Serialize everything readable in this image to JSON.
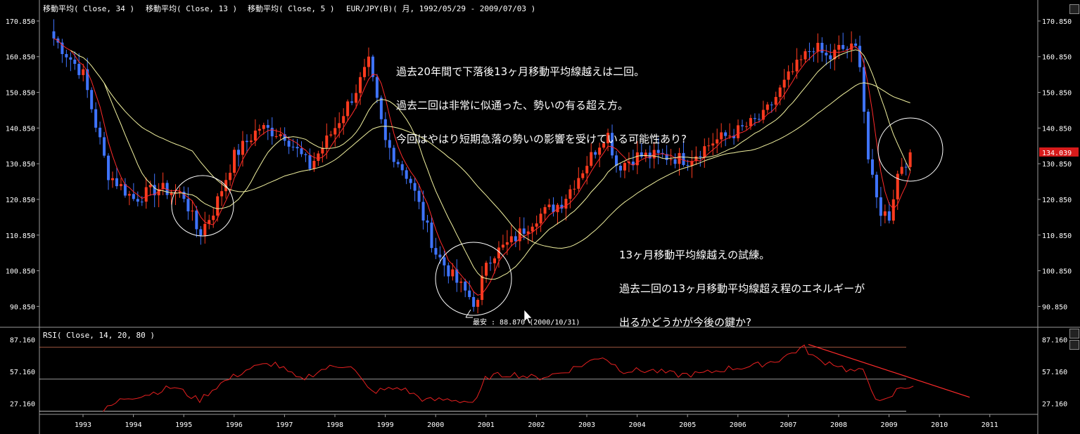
{
  "header": {
    "indicators": [
      "移動平均( Close, 34 )",
      "移動平均( Close, 13 )",
      "移動平均( Close, 5 )"
    ],
    "symbol": "EUR/JPY(B)( 月, 1992/05/29 - 2009/07/03 )"
  },
  "price_axis": {
    "ticks": [
      "170.850",
      "160.850",
      "150.850",
      "140.850",
      "130.850",
      "120.850",
      "110.850",
      "100.850",
      "90.850"
    ],
    "current_price": "134.039"
  },
  "rsi_panel": {
    "title": "RSI( Close, 14, 20, 80 )",
    "ticks": [
      "87.160",
      "57.160",
      "27.160"
    ]
  },
  "time_axis": {
    "years": [
      "1993",
      "1994",
      "1995",
      "1996",
      "1997",
      "1998",
      "1999",
      "2000",
      "2001",
      "2002",
      "2003",
      "2004",
      "2005",
      "2006",
      "2007",
      "2008",
      "2009",
      "2010",
      "2011"
    ]
  },
  "annotations": {
    "top_note": [
      "過去20年間で下落後13ヶ月移動平均線越えは二回。",
      "過去二回は非常に似通った、勢いの有る超え方。",
      "今回はやはり短期急落の勢いの影響を受けている可能性あり?"
    ],
    "right_note": [
      "13ヶ月移動平均線越えの試練。",
      "過去二回の13ヶ月移動平均線超え程のエネルギーが",
      "出るかどうかが今後の鍵か?"
    ],
    "low_label": "最安 : 88.870 (2000/10/31)"
  },
  "colors": {
    "background": "#000000",
    "up_candle": "#ff3b1f",
    "down_candle": "#3f74ff",
    "ma5": "#ff2a2a",
    "ma13": "#f2f2a0",
    "ma34": "#f2f2a0",
    "rsi_line": "#e82020",
    "trend_line": "#ff2a2a",
    "circle": "#ffffff"
  },
  "chart_data": [
    {
      "type": "candlestick",
      "title": "EUR/JPY(B)( 月, 1992/05/29 - 2009/07/03 )",
      "ylim": [
        86,
        173
      ],
      "series": [
        {
          "name": "移動平均( Close, 5 )"
        },
        {
          "name": "移動平均( Close, 13 )"
        },
        {
          "name": "移動平均( Close, 34 )"
        }
      ],
      "anchors_x": [
        1992.42,
        1993.0,
        1993.5,
        1994.0,
        1994.5,
        1995.0,
        1995.3,
        1995.6,
        1996.0,
        1996.5,
        1997.0,
        1997.5,
        1998.0,
        1998.4,
        1998.67,
        1999.0,
        1999.5,
        2000.0,
        2000.4,
        2000.83,
        2001.0,
        2001.5,
        2002.0,
        2002.5,
        2003.0,
        2003.4,
        2003.6,
        2004.0,
        2004.5,
        2005.0,
        2005.5,
        2006.0,
        2006.5,
        2007.0,
        2007.5,
        2007.8,
        2008.0,
        2008.4,
        2008.6,
        2008.8,
        2009.0,
        2009.2,
        2009.5
      ],
      "anchors_close": [
        166,
        156,
        128,
        121,
        124,
        122,
        111,
        118,
        133,
        141,
        139,
        130,
        141,
        151,
        159,
        137,
        126,
        106,
        98,
        91,
        104,
        109,
        116,
        120,
        131,
        140,
        130,
        133,
        133,
        132,
        137,
        140,
        144,
        155,
        164,
        160,
        163,
        163,
        130,
        118,
        116,
        130,
        134.039
      ]
    },
    {
      "type": "line",
      "title": "RSI( Close, 14, 20, 80 )",
      "ylim": [
        17,
        92
      ],
      "reference_lines": [
        80,
        20,
        50
      ],
      "anchors_x": [
        1993.4,
        1993.8,
        1994.3,
        1994.8,
        1995.3,
        1995.7,
        1996.3,
        1996.8,
        1997.3,
        1997.8,
        1998.3,
        1998.7,
        1999.3,
        1999.8,
        2000.3,
        2000.8,
        2001.0,
        2001.5,
        2002.0,
        2002.5,
        2003.0,
        2003.3,
        2003.7,
        2004.3,
        2004.8,
        2005.3,
        2005.8,
        2006.3,
        2006.8,
        2007.3,
        2007.6,
        2007.9,
        2008.2,
        2008.5,
        2008.8,
        2009.0,
        2009.2,
        2009.5
      ],
      "anchors_value": [
        20,
        32,
        36,
        43,
        30,
        45,
        60,
        65,
        49,
        60,
        64,
        38,
        42,
        30,
        31,
        28,
        52,
        55,
        51,
        56,
        65,
        72,
        58,
        58,
        54,
        55,
        60,
        62,
        68,
        80,
        67,
        65,
        58,
        57,
        27,
        31,
        42,
        44
      ],
      "trend_line": {
        "x": [
          2007.4,
          2010.6
        ],
        "y": [
          82.5,
          33
        ]
      }
    }
  ]
}
